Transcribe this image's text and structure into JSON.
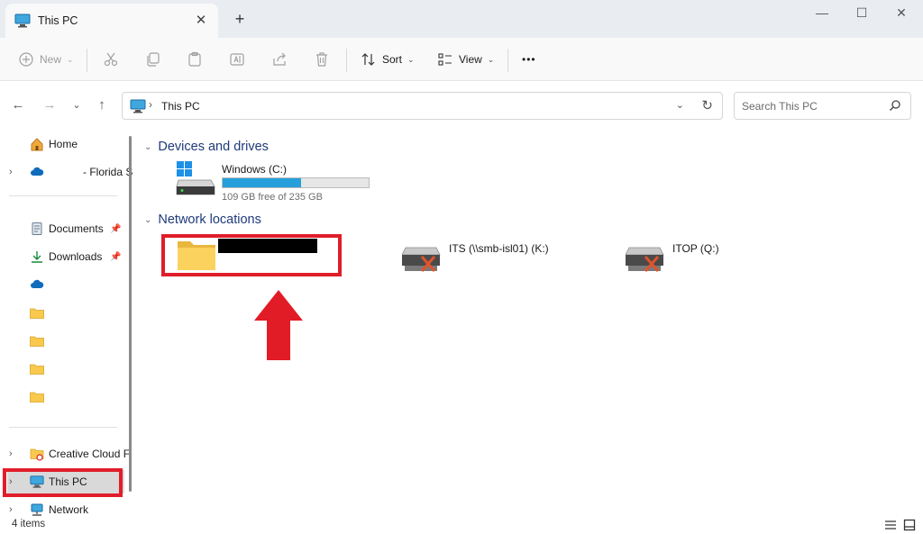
{
  "window": {
    "tab_title": "This PC",
    "tab_close": "✕",
    "new_tab": "+",
    "minimize": "—",
    "maximize": "☐",
    "close": "✕"
  },
  "toolbar": {
    "new_label": "New",
    "sort_label": "Sort",
    "view_label": "View",
    "more_label": "•••"
  },
  "address": {
    "path": "This PC",
    "search_placeholder": "Search This PC"
  },
  "sidebar": {
    "items": [
      {
        "label": "Home"
      },
      {
        "label": "- Florida S"
      },
      {
        "label": "Documents"
      },
      {
        "label": "Downloads"
      },
      {
        "label": ""
      },
      {
        "label": ""
      },
      {
        "label": ""
      },
      {
        "label": ""
      },
      {
        "label": ""
      },
      {
        "label": "Creative Cloud F"
      },
      {
        "label": "This PC"
      },
      {
        "label": "Network"
      }
    ]
  },
  "content": {
    "devices_header": "Devices and drives",
    "drive": {
      "name": "Windows (C:)",
      "free": "109 GB free of 235 GB",
      "used_fraction": 0.536
    },
    "network_header": "Network locations",
    "network_items": [
      {
        "name": ""
      },
      {
        "name": "ITS (\\\\smb-isl01) (K:)"
      },
      {
        "name": "ITOP (Q:)"
      }
    ]
  },
  "status": {
    "item_count": "4 items"
  },
  "colors": {
    "annotation_red": "#e01e2b",
    "drive_fill": "#26a0da",
    "header_blue": "#1f3a7a"
  }
}
